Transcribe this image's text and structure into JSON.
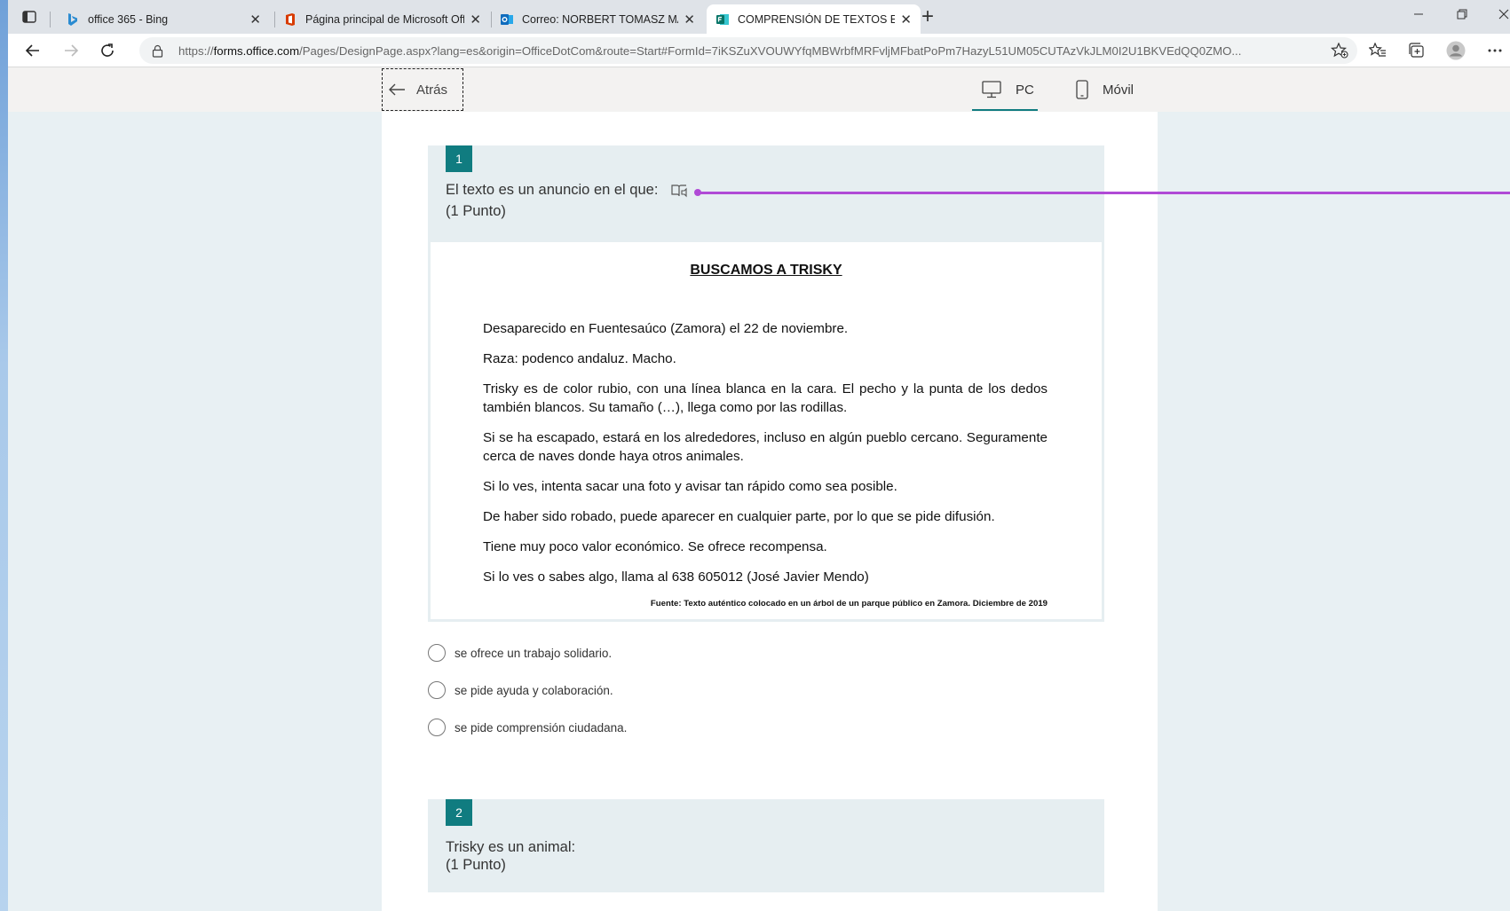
{
  "browser": {
    "tabs": [
      {
        "title": "office 365 - Bing",
        "active": false
      },
      {
        "title": "Página principal de Microsoft Office",
        "active": false
      },
      {
        "title": "Correo: NORBERT TOMASZ MAJ",
        "active": false
      },
      {
        "title": "COMPRENSIÓN DE TEXTOS ESCRITOS",
        "active": true
      }
    ],
    "close_glyph": "✕",
    "new_tab_glyph": "+",
    "url_prefix": "https://",
    "url_domain": "forms.office.com",
    "url_path": "/Pages/DesignPage.aspx?lang=es&origin=OfficeDotCom&route=Start#FormId=7iKSZuXVOUWYfqMBWrbfMRFvljMFbatPoPm7HazyL51UM05CUTAzVkJLM0I2U1BKVEdQQ0ZMO..."
  },
  "forms_bar": {
    "back_label": "Atrás",
    "pc_label": "PC",
    "mobile_label": "Móvil",
    "selected_view": "PC"
  },
  "questions": [
    {
      "number": "1",
      "title": "El texto es un anuncio en el que:",
      "points": "(1 Punto)",
      "options": [
        "se ofrece un trabajo solidario.",
        "se pide ayuda y colaboración.",
        "se pide comprensión ciudadana."
      ]
    },
    {
      "number": "2",
      "title": "Trisky es un animal:",
      "points": "(1 Punto)"
    }
  ],
  "document": {
    "title": "BUSCAMOS A TRISKY",
    "paragraphs": [
      "Desaparecido en Fuentesaúco (Zamora) el 22 de noviembre.",
      "Raza: podenco andaluz. Macho.",
      "Trisky es de color rubio, con una línea blanca en la cara. El pecho y la punta de los dedos también blancos. Su tamaño (…), llega como por las rodillas.",
      "Si se ha escapado, estará en los alrededores, incluso en algún pueblo cercano. Seguramente cerca de naves donde haya otros animales.",
      "Si lo ves, intenta sacar una foto y avisar tan rápido como sea posible.",
      "De haber sido robado, puede aparecer en cualquier parte, por lo que se pide difusión.",
      "Tiene muy poco valor económico. Se ofrece recompensa.",
      "Si lo ves o sabes algo, llama al 638 605012 (José Javier Mendo)"
    ],
    "source": "Fuente: Texto auténtico colocado en un árbol de un parque público en Zamora. Diciembre de 2019"
  },
  "colors": {
    "accent": "#107c80",
    "annotation": "#b04ad6",
    "page_bg": "#e8f0f3"
  }
}
